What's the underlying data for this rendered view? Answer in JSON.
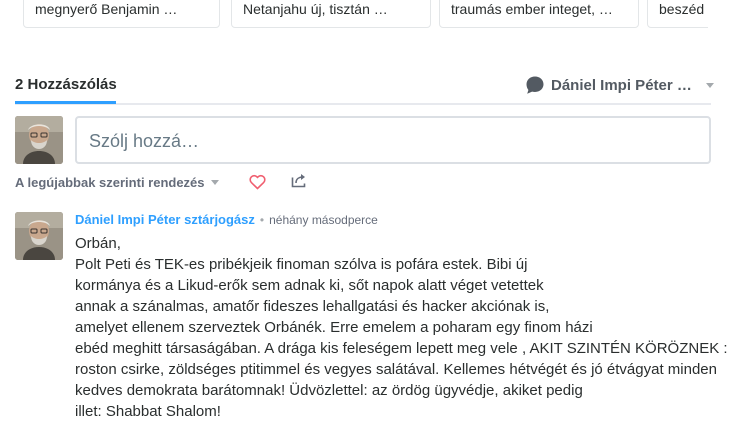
{
  "related_cards": [
    {
      "text": "megnyerő Benjamin …"
    },
    {
      "text": "Netanjahu új, tisztán …"
    },
    {
      "text": "traumás ember integet, …"
    },
    {
      "text": "beszéd"
    }
  ],
  "tabs": {
    "comment_count_label": "2 Hozzászólás",
    "accent_color": "#2e9fff"
  },
  "user_menu": {
    "name": "Dániel Impi Péter …",
    "icon": "speech-bubble-icon"
  },
  "composer": {
    "placeholder": "Szólj hozzá…",
    "value": ""
  },
  "toolbar": {
    "sort_label": "A legújabbak szerinti rendezés",
    "favorite_icon": "heart-icon",
    "share_icon": "share-icon",
    "favorite_color": "#f05f70"
  },
  "comment": {
    "author": "Dániel Impi Péter sztárjogász",
    "separator": "•",
    "timestamp": "néhány másodperce",
    "lines": [
      "Orbán,",
      "Polt Peti és TEK-es pribékjeik finoman szólva is pofára estek. Bibi új",
      "kormánya és a Likud-erők sem adnak ki, sőt napok alatt véget vetettek",
      "annak a szánalmas, amatőr fideszes lehallgatási és hacker akciónak is,",
      "amelyet ellenem szerveztek Orbánék. Erre emelem a poharam egy finom házi",
      "ebéd meghitt társaságában. A drága kis feleségem lepett meg vele , AKIT SZINTÉN KÖRÖZNEK :",
      "roston csirke, zöldséges ptitimmel és vegyes salátával. Kellemes hétvégét és jó étvágyat minden",
      "kedves demokrata barátomnak! Üdvözlettel: az ördög ügyvédje, akiket pedig",
      "illet: Shabbat Shalom!"
    ]
  }
}
